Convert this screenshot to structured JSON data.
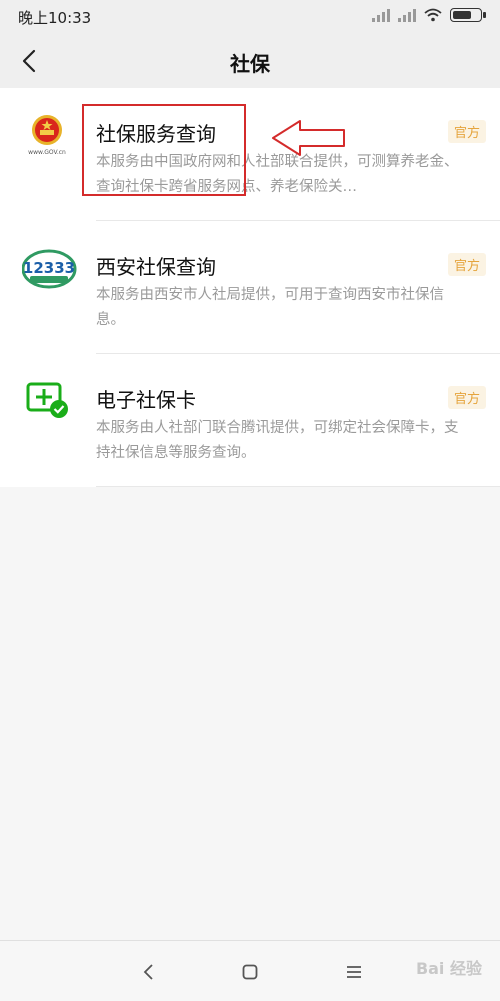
{
  "status_bar": {
    "time": "晚上10:33"
  },
  "header": {
    "title": "社保"
  },
  "items": [
    {
      "title": "社保服务查询",
      "desc": "本服务由中国政府网和人社部联合提供，可测算养老金、查询社保卡跨省服务网点、养老保险关…",
      "badge": "官方",
      "icon": "gov-emblem-icon",
      "icon_caption": "www.GOV.cn"
    },
    {
      "title": "西安社保查询",
      "desc": "本服务由西安市人社局提供，可用于查询西安市社保信息。",
      "badge": "官方",
      "icon": "12333-logo-icon",
      "icon_caption": "12333"
    },
    {
      "title": "电子社保卡",
      "desc": "本服务由人社部门联合腾讯提供，可绑定社会保障卡，支持社保信息等服务查询。",
      "badge": "官方",
      "icon": "social-security-card-icon"
    }
  ],
  "watermark": "Bai 经验",
  "colors": {
    "badge_bg": "#fbf3e3",
    "badge_text": "#e5a43d",
    "annotation": "#d42b2b",
    "card_green": "#1aad19"
  }
}
